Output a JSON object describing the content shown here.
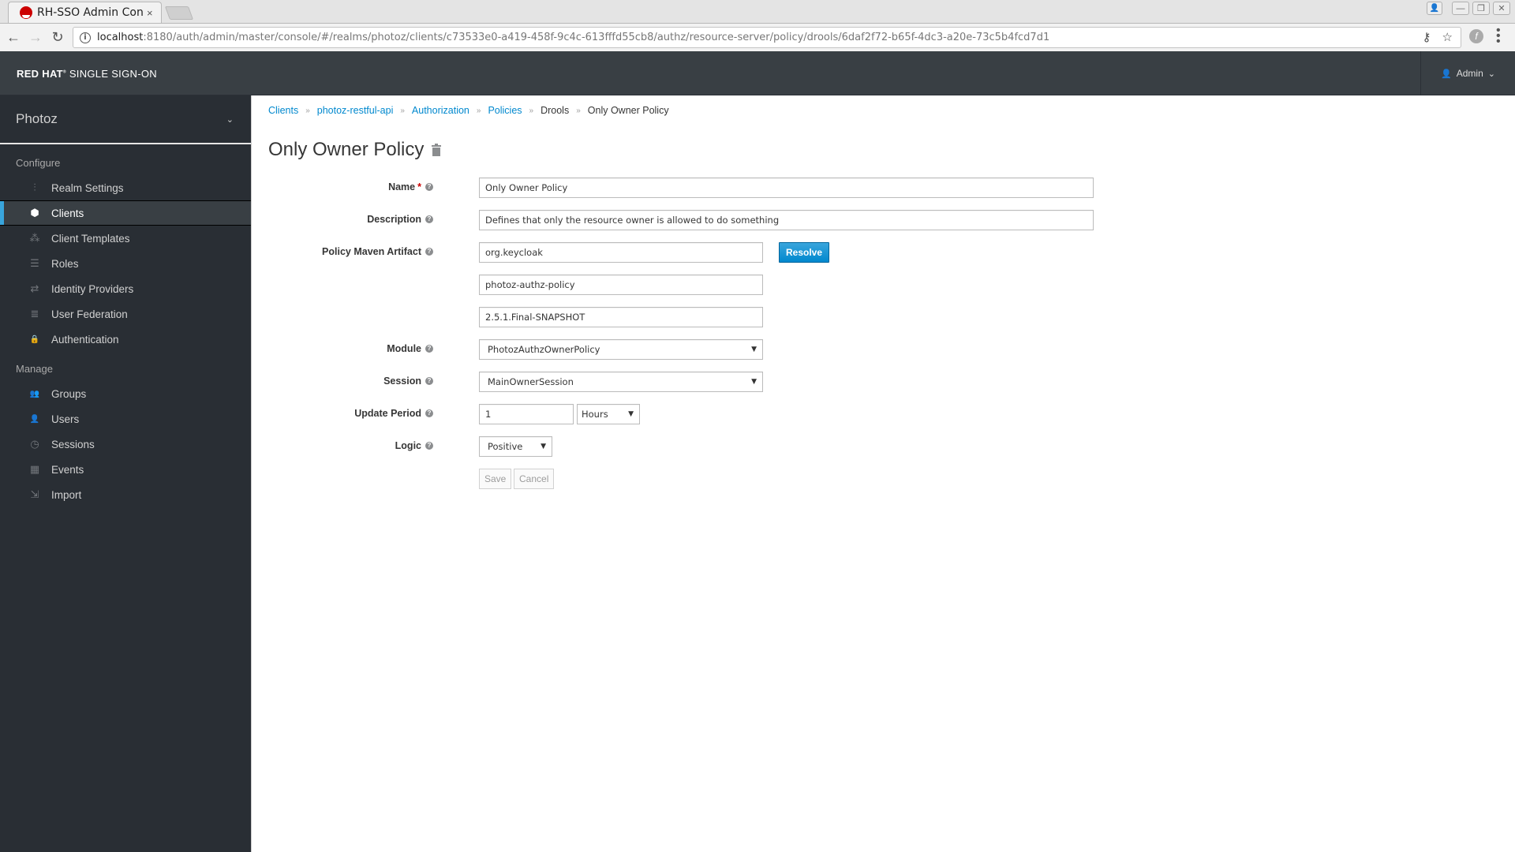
{
  "browser": {
    "tab_title": "RH-SSO Admin Cons",
    "tab_close": "×",
    "url_host": "localhost",
    "url_rest": ":8180/auth/admin/master/console/#/realms/photoz/clients/c73533e0-a419-458f-9c4c-613fffd55cb8/authz/resource-server/policy/drools/6daf2f72-b65f-4dc3-a20e-73c5b4fcd7d1",
    "info_icon": "i",
    "back_icon": "←",
    "forward_icon": "→",
    "reload_icon": "↻",
    "key_icon": "⚷",
    "star_icon": "☆",
    "ext_icon": "f",
    "menu_icon": "⋮",
    "profile_icon": "👤",
    "minimize_icon": "—",
    "restore_icon": "❐",
    "close_icon": "✕"
  },
  "header": {
    "brand_bold": "RED HAT",
    "brand_mark": "®",
    "brand_rest": " SINGLE SIGN-ON",
    "user_icon": "👤",
    "user_label": "Admin",
    "user_caret": "⌄"
  },
  "sidebar": {
    "realm": "Photoz",
    "realm_caret": "⌄",
    "configure_label": "Configure",
    "configure_items": [
      {
        "label": "Realm Settings",
        "icon": "⫶"
      },
      {
        "label": "Clients",
        "icon": "⬢"
      },
      {
        "label": "Client Templates",
        "icon": "⁂"
      },
      {
        "label": "Roles",
        "icon": "☰"
      },
      {
        "label": "Identity Providers",
        "icon": "⇄"
      },
      {
        "label": "User Federation",
        "icon": "≣"
      },
      {
        "label": "Authentication",
        "icon": "🔒"
      }
    ],
    "manage_label": "Manage",
    "manage_items": [
      {
        "label": "Groups",
        "icon": "👥"
      },
      {
        "label": "Users",
        "icon": "👤"
      },
      {
        "label": "Sessions",
        "icon": "◷"
      },
      {
        "label": "Events",
        "icon": "▦"
      },
      {
        "label": "Import",
        "icon": "⇲"
      }
    ],
    "active": "Clients"
  },
  "breadcrumb": {
    "items": [
      "Clients",
      "photoz-restful-api",
      "Authorization",
      "Policies"
    ],
    "plain": "Drools",
    "current": "Only Owner Policy",
    "separator": "»"
  },
  "page": {
    "title": "Only Owner Policy"
  },
  "form": {
    "help_glyph": "?",
    "required_mark": "*",
    "name_label": "Name",
    "name_value": "Only Owner Policy",
    "description_label": "Description",
    "description_value": "Defines that only the resource owner is allowed to do something",
    "artifact_label": "Policy Maven Artifact",
    "group_id": "org.keycloak",
    "artifact_id": "photoz-authz-policy",
    "version": "2.5.1.Final-SNAPSHOT",
    "resolve_label": "Resolve",
    "module_label": "Module",
    "module_value": "PhotozAuthzOwnerPolicy",
    "session_label": "Session",
    "session_value": "MainOwnerSession",
    "update_period_label": "Update Period",
    "update_period_value": "1",
    "update_period_unit": "Hours",
    "logic_label": "Logic",
    "logic_value": "Positive",
    "caret": "▼",
    "save_label": "Save",
    "cancel_label": "Cancel"
  }
}
